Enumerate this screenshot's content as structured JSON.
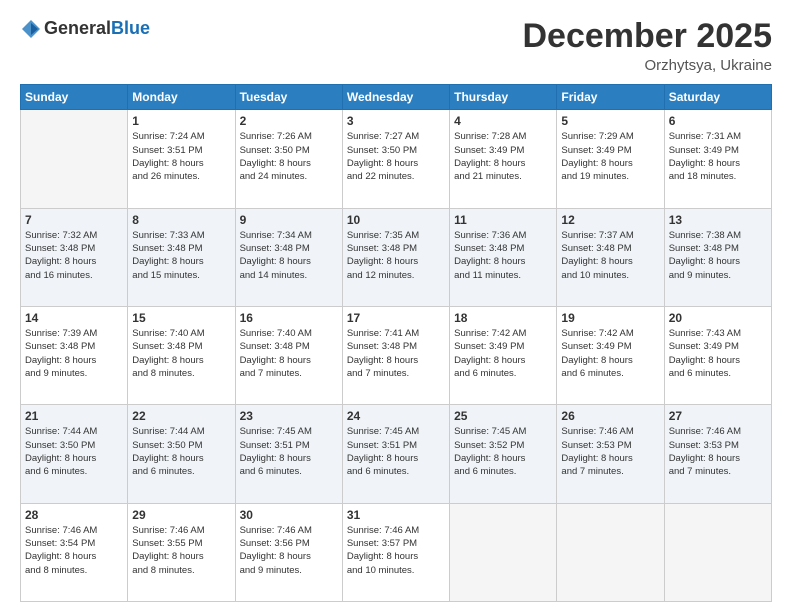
{
  "logo": {
    "general": "General",
    "blue": "Blue"
  },
  "header": {
    "month": "December 2025",
    "location": "Orzhytsya, Ukraine"
  },
  "weekdays": [
    "Sunday",
    "Monday",
    "Tuesday",
    "Wednesday",
    "Thursday",
    "Friday",
    "Saturday"
  ],
  "weeks": [
    [
      {
        "day": "",
        "info": ""
      },
      {
        "day": "1",
        "info": "Sunrise: 7:24 AM\nSunset: 3:51 PM\nDaylight: 8 hours\nand 26 minutes."
      },
      {
        "day": "2",
        "info": "Sunrise: 7:26 AM\nSunset: 3:50 PM\nDaylight: 8 hours\nand 24 minutes."
      },
      {
        "day": "3",
        "info": "Sunrise: 7:27 AM\nSunset: 3:50 PM\nDaylight: 8 hours\nand 22 minutes."
      },
      {
        "day": "4",
        "info": "Sunrise: 7:28 AM\nSunset: 3:49 PM\nDaylight: 8 hours\nand 21 minutes."
      },
      {
        "day": "5",
        "info": "Sunrise: 7:29 AM\nSunset: 3:49 PM\nDaylight: 8 hours\nand 19 minutes."
      },
      {
        "day": "6",
        "info": "Sunrise: 7:31 AM\nSunset: 3:49 PM\nDaylight: 8 hours\nand 18 minutes."
      }
    ],
    [
      {
        "day": "7",
        "info": "Sunrise: 7:32 AM\nSunset: 3:48 PM\nDaylight: 8 hours\nand 16 minutes."
      },
      {
        "day": "8",
        "info": "Sunrise: 7:33 AM\nSunset: 3:48 PM\nDaylight: 8 hours\nand 15 minutes."
      },
      {
        "day": "9",
        "info": "Sunrise: 7:34 AM\nSunset: 3:48 PM\nDaylight: 8 hours\nand 14 minutes."
      },
      {
        "day": "10",
        "info": "Sunrise: 7:35 AM\nSunset: 3:48 PM\nDaylight: 8 hours\nand 12 minutes."
      },
      {
        "day": "11",
        "info": "Sunrise: 7:36 AM\nSunset: 3:48 PM\nDaylight: 8 hours\nand 11 minutes."
      },
      {
        "day": "12",
        "info": "Sunrise: 7:37 AM\nSunset: 3:48 PM\nDaylight: 8 hours\nand 10 minutes."
      },
      {
        "day": "13",
        "info": "Sunrise: 7:38 AM\nSunset: 3:48 PM\nDaylight: 8 hours\nand 9 minutes."
      }
    ],
    [
      {
        "day": "14",
        "info": "Sunrise: 7:39 AM\nSunset: 3:48 PM\nDaylight: 8 hours\nand 9 minutes."
      },
      {
        "day": "15",
        "info": "Sunrise: 7:40 AM\nSunset: 3:48 PM\nDaylight: 8 hours\nand 8 minutes."
      },
      {
        "day": "16",
        "info": "Sunrise: 7:40 AM\nSunset: 3:48 PM\nDaylight: 8 hours\nand 7 minutes."
      },
      {
        "day": "17",
        "info": "Sunrise: 7:41 AM\nSunset: 3:48 PM\nDaylight: 8 hours\nand 7 minutes."
      },
      {
        "day": "18",
        "info": "Sunrise: 7:42 AM\nSunset: 3:49 PM\nDaylight: 8 hours\nand 6 minutes."
      },
      {
        "day": "19",
        "info": "Sunrise: 7:42 AM\nSunset: 3:49 PM\nDaylight: 8 hours\nand 6 minutes."
      },
      {
        "day": "20",
        "info": "Sunrise: 7:43 AM\nSunset: 3:49 PM\nDaylight: 8 hours\nand 6 minutes."
      }
    ],
    [
      {
        "day": "21",
        "info": "Sunrise: 7:44 AM\nSunset: 3:50 PM\nDaylight: 8 hours\nand 6 minutes."
      },
      {
        "day": "22",
        "info": "Sunrise: 7:44 AM\nSunset: 3:50 PM\nDaylight: 8 hours\nand 6 minutes."
      },
      {
        "day": "23",
        "info": "Sunrise: 7:45 AM\nSunset: 3:51 PM\nDaylight: 8 hours\nand 6 minutes."
      },
      {
        "day": "24",
        "info": "Sunrise: 7:45 AM\nSunset: 3:51 PM\nDaylight: 8 hours\nand 6 minutes."
      },
      {
        "day": "25",
        "info": "Sunrise: 7:45 AM\nSunset: 3:52 PM\nDaylight: 8 hours\nand 6 minutes."
      },
      {
        "day": "26",
        "info": "Sunrise: 7:46 AM\nSunset: 3:53 PM\nDaylight: 8 hours\nand 7 minutes."
      },
      {
        "day": "27",
        "info": "Sunrise: 7:46 AM\nSunset: 3:53 PM\nDaylight: 8 hours\nand 7 minutes."
      }
    ],
    [
      {
        "day": "28",
        "info": "Sunrise: 7:46 AM\nSunset: 3:54 PM\nDaylight: 8 hours\nand 8 minutes."
      },
      {
        "day": "29",
        "info": "Sunrise: 7:46 AM\nSunset: 3:55 PM\nDaylight: 8 hours\nand 8 minutes."
      },
      {
        "day": "30",
        "info": "Sunrise: 7:46 AM\nSunset: 3:56 PM\nDaylight: 8 hours\nand 9 minutes."
      },
      {
        "day": "31",
        "info": "Sunrise: 7:46 AM\nSunset: 3:57 PM\nDaylight: 8 hours\nand 10 minutes."
      },
      {
        "day": "",
        "info": ""
      },
      {
        "day": "",
        "info": ""
      },
      {
        "day": "",
        "info": ""
      }
    ]
  ]
}
